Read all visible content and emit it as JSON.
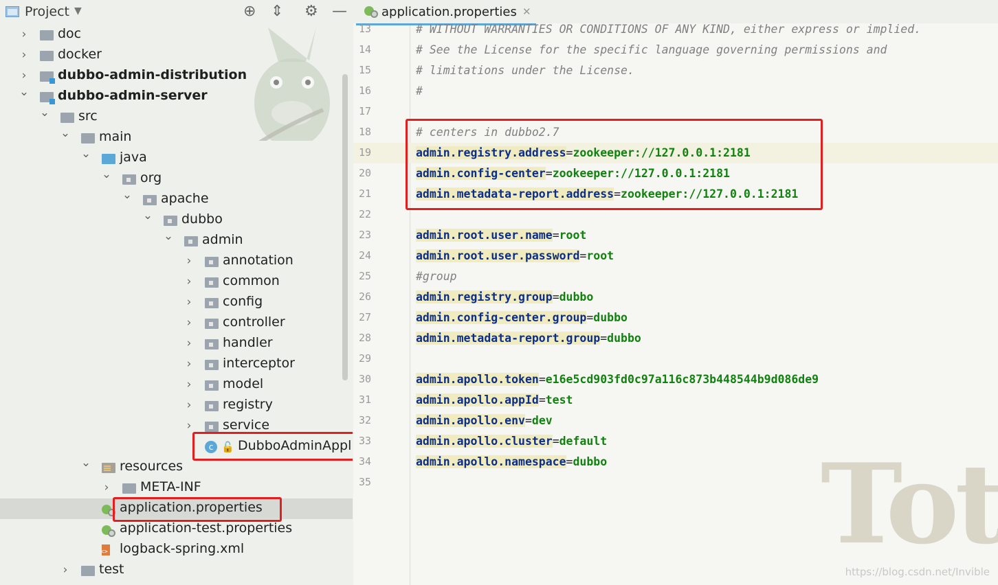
{
  "project_panel": {
    "title": "Project",
    "tree": [
      {
        "label": "doc",
        "indent": 0,
        "expanded": false,
        "icon": "folder-icon"
      },
      {
        "label": "docker",
        "indent": 0,
        "expanded": false,
        "icon": "folder-icon"
      },
      {
        "label": "dubbo-admin-distribution",
        "indent": 0,
        "expanded": false,
        "icon": "module-folder-icon",
        "bold": true
      },
      {
        "label": "dubbo-admin-server",
        "indent": 0,
        "expanded": true,
        "icon": "module-folder-icon",
        "bold": true
      },
      {
        "label": "src",
        "indent": 1,
        "expanded": true,
        "icon": "folder-icon"
      },
      {
        "label": "main",
        "indent": 2,
        "expanded": true,
        "icon": "folder-icon"
      },
      {
        "label": "java",
        "indent": 3,
        "expanded": true,
        "icon": "source-folder-icon"
      },
      {
        "label": "org",
        "indent": 4,
        "expanded": true,
        "icon": "package-icon"
      },
      {
        "label": "apache",
        "indent": 5,
        "expanded": true,
        "icon": "package-icon"
      },
      {
        "label": "dubbo",
        "indent": 6,
        "expanded": true,
        "icon": "package-icon"
      },
      {
        "label": "admin",
        "indent": 7,
        "expanded": true,
        "icon": "package-icon"
      },
      {
        "label": "annotation",
        "indent": 8,
        "expanded": false,
        "icon": "package-icon"
      },
      {
        "label": "common",
        "indent": 8,
        "expanded": false,
        "icon": "package-icon"
      },
      {
        "label": "config",
        "indent": 8,
        "expanded": false,
        "icon": "package-icon"
      },
      {
        "label": "controller",
        "indent": 8,
        "expanded": false,
        "icon": "package-icon"
      },
      {
        "label": "handler",
        "indent": 8,
        "expanded": false,
        "icon": "package-icon"
      },
      {
        "label": "interceptor",
        "indent": 8,
        "expanded": false,
        "icon": "package-icon"
      },
      {
        "label": "model",
        "indent": 8,
        "expanded": false,
        "icon": "package-icon"
      },
      {
        "label": "registry",
        "indent": 8,
        "expanded": false,
        "icon": "package-icon"
      },
      {
        "label": "service",
        "indent": 8,
        "expanded": false,
        "icon": "package-icon"
      },
      {
        "label": "DubboAdminAppli",
        "indent": 9,
        "leaf": true,
        "icon": "spring-class-icon",
        "highlighted": true
      },
      {
        "label": "resources",
        "indent": 3,
        "expanded": true,
        "icon": "resources-folder-icon"
      },
      {
        "label": "META-INF",
        "indent": 4,
        "expanded": false,
        "icon": "folder-icon"
      },
      {
        "label": "application.properties",
        "indent": 4,
        "leaf": true,
        "icon": "spring-properties-icon",
        "selected": true,
        "highlighted": true
      },
      {
        "label": "application-test.properties",
        "indent": 4,
        "leaf": true,
        "icon": "spring-properties-icon"
      },
      {
        "label": "logback-spring.xml",
        "indent": 4,
        "leaf": true,
        "icon": "xml-icon"
      },
      {
        "label": "test",
        "indent": 2,
        "expanded": false,
        "icon": "folder-icon"
      }
    ]
  },
  "editor": {
    "tab_label": "application.properties",
    "lines": [
      {
        "n": "13",
        "type": "comment",
        "text": "# WITHOUT WARRANTIES OR CONDITIONS OF ANY KIND, either express or implied."
      },
      {
        "n": "14",
        "type": "comment",
        "text": "# See the License for the specific language governing permissions and"
      },
      {
        "n": "15",
        "type": "comment",
        "text": "# limitations under the License."
      },
      {
        "n": "16",
        "type": "comment",
        "text": "#"
      },
      {
        "n": "17",
        "type": "blank"
      },
      {
        "n": "18",
        "type": "comment",
        "text": "# centers in dubbo2.7"
      },
      {
        "n": "19",
        "type": "prop",
        "key": "admin.registry.address",
        "value": "zookeeper://127.0.0.1:2181",
        "current": true
      },
      {
        "n": "20",
        "type": "prop",
        "key": "admin.config-center",
        "value": "zookeeper://127.0.0.1:2181"
      },
      {
        "n": "21",
        "type": "prop",
        "key": "admin.metadata-report.address",
        "value": "zookeeper://127.0.0.1:2181"
      },
      {
        "n": "22",
        "type": "blank"
      },
      {
        "n": "23",
        "type": "prop",
        "key": "admin.root.user.name",
        "value": "root"
      },
      {
        "n": "24",
        "type": "prop",
        "key": "admin.root.user.password",
        "value": "root"
      },
      {
        "n": "25",
        "type": "comment",
        "text": "#group"
      },
      {
        "n": "26",
        "type": "prop",
        "key": "admin.registry.group",
        "value": "dubbo"
      },
      {
        "n": "27",
        "type": "prop",
        "key": "admin.config-center.group",
        "value": "dubbo"
      },
      {
        "n": "28",
        "type": "prop",
        "key": "admin.metadata-report.group",
        "value": "dubbo"
      },
      {
        "n": "29",
        "type": "blank"
      },
      {
        "n": "30",
        "type": "prop",
        "key": "admin.apollo.token",
        "value": "e16e5cd903fd0c97a116c873b448544b9d086de9"
      },
      {
        "n": "31",
        "type": "prop",
        "key": "admin.apollo.appId",
        "value": "test"
      },
      {
        "n": "32",
        "type": "prop",
        "key": "admin.apollo.env",
        "value": "dev"
      },
      {
        "n": "33",
        "type": "prop",
        "key": "admin.apollo.cluster",
        "value": "default"
      },
      {
        "n": "34",
        "type": "prop",
        "key": "admin.apollo.namespace",
        "value": "dubbo"
      },
      {
        "n": "35",
        "type": "blank"
      }
    ]
  },
  "background_text": "Toto",
  "watermark": "https://blog.csdn.net/Invible",
  "colors": {
    "highlight_box": "#e41e1e",
    "key": "#0b2e8a",
    "value": "#11820f",
    "comment": "#808080"
  }
}
